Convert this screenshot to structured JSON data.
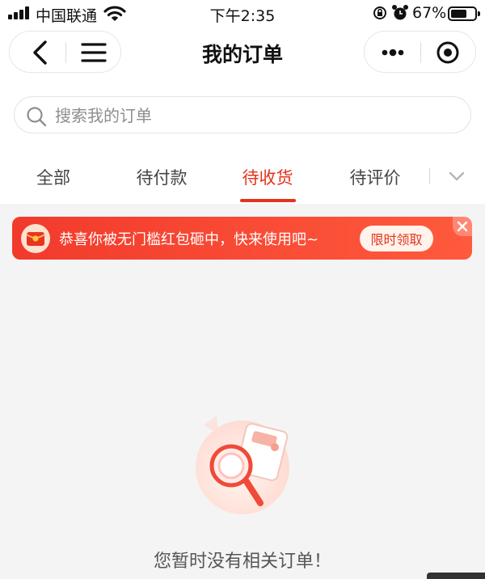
{
  "status_bar": {
    "carrier": "中国联通",
    "time": "下午2:35",
    "battery_percent": "67%",
    "battery_level": 0.67
  },
  "header": {
    "title": "我的订单"
  },
  "search": {
    "placeholder": "搜索我的订单"
  },
  "tabs": [
    {
      "label": "全部",
      "active": false
    },
    {
      "label": "待付款",
      "active": false
    },
    {
      "label": "待收货",
      "active": true
    },
    {
      "label": "待评价",
      "active": false
    }
  ],
  "promo": {
    "text": "恭喜你被无门槛红包砸中，快来使用吧~",
    "button_label": "限时领取"
  },
  "empty_state": {
    "message": "您暂时没有相关订单！"
  },
  "colors": {
    "accent": "#e4331c",
    "banner": "#f23a2c",
    "background": "#f4f4f4"
  },
  "icons": [
    "signal-icon",
    "wifi-icon",
    "rotation-lock-icon",
    "alarm-icon",
    "battery-icon",
    "back-icon",
    "menu-icon",
    "more-icon",
    "target-icon",
    "search-icon",
    "chevron-down-icon",
    "red-envelope-icon",
    "close-icon",
    "magnifier-illustration"
  ]
}
